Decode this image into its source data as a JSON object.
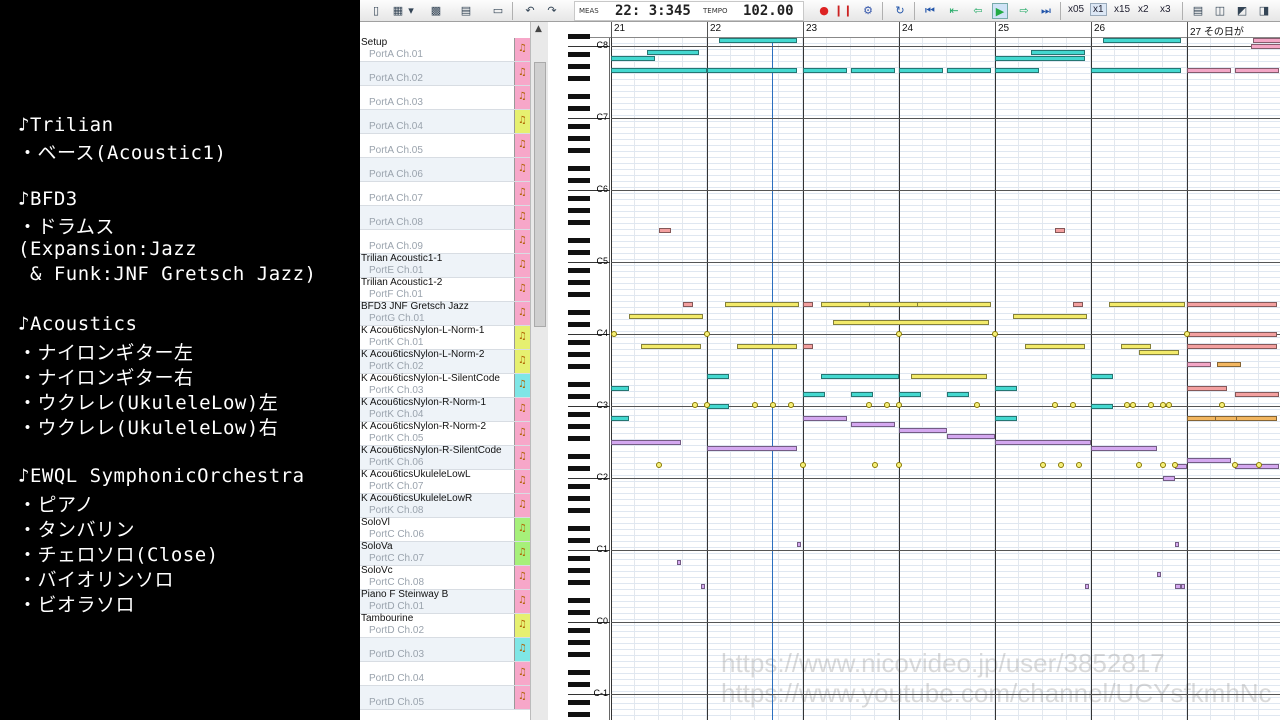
{
  "notes_panel": [
    "♪Trilian",
    "・ベース(Acoustic1)",
    "♪BFD3",
    "・ドラムス",
    "(Expansion:Jazz",
    " & Funk:JNF Gretsch Jazz)",
    "♪Acoustics",
    "・ナイロンギター左",
    "・ナイロンギター右",
    "・ウクレレ(UkuleleLow)左",
    "・ウクレレ(UkuleleLow)右",
    "♪EWQL SymphonicOrchestra",
    "・ピアノ",
    "・タンバリン",
    "・チェロソロ(Close)",
    "・バイオリンソロ",
    "・ビオラソロ"
  ],
  "toolbar": {
    "meas_label": "MEAS",
    "position": "22: 3:345",
    "tempo_label": "TEMPO",
    "tempo": "102.00",
    "speeds": [
      "x05",
      "x1",
      "x15",
      "x2",
      "x3"
    ],
    "selected_speed": "x1",
    "buttons": [
      "new-icon",
      "open-icon",
      "save-icon",
      "props-icon",
      "page-icon",
      "undo-icon",
      "redo-icon",
      "record-icon",
      "stop-icon",
      "mixer-icon",
      "loop-icon",
      "rewind-start-icon",
      "rewind-icon",
      "back-icon",
      "play-icon",
      "forward-icon",
      "forward-end-icon"
    ]
  },
  "tracks": [
    {
      "name": "Setup",
      "port": "PortA  Ch.01",
      "color": "#f7a7c9"
    },
    {
      "name": "",
      "port": "PortA  Ch.02",
      "color": "#f7a7c9"
    },
    {
      "name": "",
      "port": "PortA  Ch.03",
      "color": "#f7a7c9"
    },
    {
      "name": "",
      "port": "PortA  Ch.04",
      "color": "#e6f070"
    },
    {
      "name": "",
      "port": "PortA  Ch.05",
      "color": "#f7a7c9"
    },
    {
      "name": "",
      "port": "PortA  Ch.06",
      "color": "#f7a7c9"
    },
    {
      "name": "",
      "port": "PortA  Ch.07",
      "color": "#f7a7c9"
    },
    {
      "name": "",
      "port": "PortA  Ch.08",
      "color": "#f7a7c9"
    },
    {
      "name": "",
      "port": "PortA  Ch.09",
      "color": "#f7a7c9"
    },
    {
      "name": "Trilian Acoustic1-1",
      "port": "PortE  Ch.01",
      "color": "#f7a7c9"
    },
    {
      "name": "Trilian Acoustic1-2",
      "port": "PortF  Ch.01",
      "color": "#f7a7c9"
    },
    {
      "name": "BFD3 JNF Gretsch Jazz",
      "port": "PortG  Ch.01",
      "color": "#f7a7c9"
    },
    {
      "name": "K Acou6ticsNylon-L-Norm-1",
      "port": "PortK  Ch.01",
      "color": "#e6f070"
    },
    {
      "name": "K Acou6ticsNylon-L-Norm-2",
      "port": "PortK  Ch.02",
      "color": "#e6f070"
    },
    {
      "name": "K Acou6ticsNylon-L-SilentCode",
      "port": "PortK  Ch.03",
      "color": "#7fe6e6"
    },
    {
      "name": "K Acou6ticsNylon-R-Norm-1",
      "port": "PortK  Ch.04",
      "color": "#f7a7c9"
    },
    {
      "name": "K Acou6ticsNylon-R-Norm-2",
      "port": "PortK  Ch.05",
      "color": "#f7a7c9"
    },
    {
      "name": "K Acou6ticsNylon-R-SilentCode",
      "port": "PortK  Ch.06",
      "color": "#f7a7c9"
    },
    {
      "name": "K Acou6ticsUkuleleLowL",
      "port": "PortK  Ch.07",
      "color": "#f7a7c9"
    },
    {
      "name": "K Acou6ticsUkuleleLowR",
      "port": "PortK  Ch.08",
      "color": "#f7a7c9"
    },
    {
      "name": "SoloVl",
      "port": "PortC  Ch.06",
      "color": "#a6f07a"
    },
    {
      "name": "SoloVa",
      "port": "PortC  Ch.07",
      "color": "#a6f07a"
    },
    {
      "name": "SoloVc",
      "port": "PortC  Ch.08",
      "color": "#f7a7c9"
    },
    {
      "name": "Piano F Steinway B",
      "port": "PortD  Ch.01",
      "color": "#f7a7c9"
    },
    {
      "name": "Tambourine",
      "port": "PortD  Ch.02",
      "color": "#e6f070"
    },
    {
      "name": "",
      "port": "PortD  Ch.03",
      "color": "#7fe6e6"
    },
    {
      "name": "",
      "port": "PortD  Ch.04",
      "color": "#f7a7c9"
    },
    {
      "name": "",
      "port": "PortD  Ch.05",
      "color": "#f7a7c9"
    }
  ],
  "ruler": {
    "measures": [
      "21",
      "22",
      "23",
      "24",
      "25",
      "26",
      "27 その日が"
    ]
  },
  "keyboard": {
    "octaves": [
      "C8",
      "C7",
      "C6",
      "C5",
      "C4",
      "C3",
      "C2",
      "C1",
      "C0",
      "C-1"
    ]
  },
  "watermark": {
    "line1": "https://www.nicovideo.jp/user/3852817",
    "line2": "https://www.youtube.com/channel/UCYsfkmhNc"
  },
  "colors": {
    "cyan": "#44d8d0",
    "yellow": "#f2ea6a",
    "pink": "#f3a6c6",
    "purple": "#d4a8f0",
    "orange": "#f2b660",
    "salmon": "#f3a0a0"
  }
}
